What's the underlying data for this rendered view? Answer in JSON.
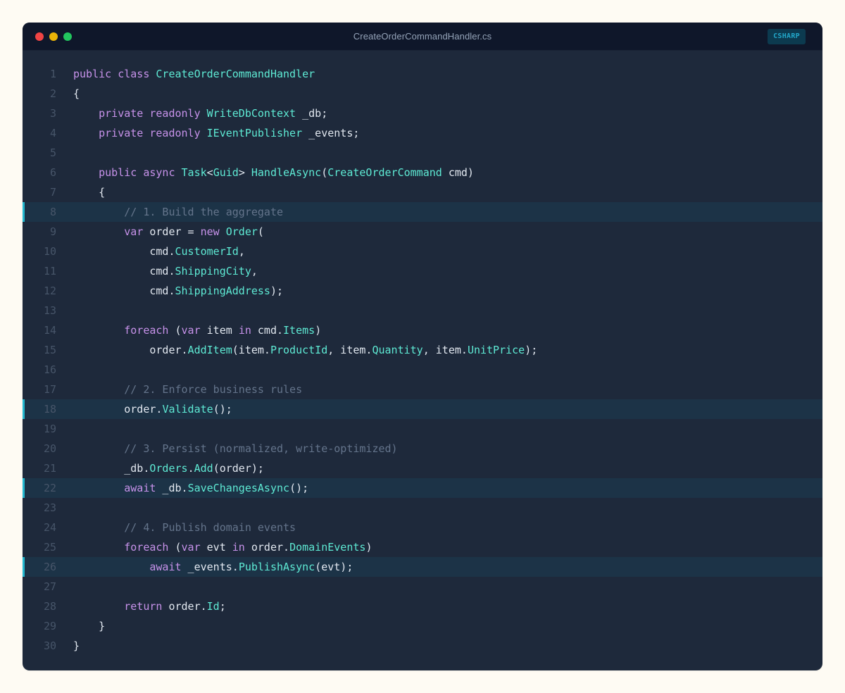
{
  "window": {
    "filename": "CreateOrderCommandHandler.cs",
    "language_badge": "CSHARP"
  },
  "colors": {
    "keyword": "#c792ea",
    "type": "#5eead4",
    "comment": "#64748b",
    "plain": "#e2e8f0",
    "highlight_bar": "#22b8cf",
    "background": "#1e293b"
  },
  "lines": [
    {
      "n": "1",
      "hl": false,
      "tokens": [
        [
          "kw",
          "public"
        ],
        [
          "pl",
          " "
        ],
        [
          "kw",
          "class"
        ],
        [
          "pl",
          " "
        ],
        [
          "ty",
          "CreateOrderCommandHandler"
        ]
      ]
    },
    {
      "n": "2",
      "hl": false,
      "tokens": [
        [
          "pl",
          "{"
        ]
      ]
    },
    {
      "n": "3",
      "hl": false,
      "tokens": [
        [
          "pl",
          "    "
        ],
        [
          "kw",
          "private"
        ],
        [
          "pl",
          " "
        ],
        [
          "kw",
          "readonly"
        ],
        [
          "pl",
          " "
        ],
        [
          "ty",
          "WriteDbContext"
        ],
        [
          "pl",
          " _db;"
        ]
      ]
    },
    {
      "n": "4",
      "hl": false,
      "tokens": [
        [
          "pl",
          "    "
        ],
        [
          "kw",
          "private"
        ],
        [
          "pl",
          " "
        ],
        [
          "kw",
          "readonly"
        ],
        [
          "pl",
          " "
        ],
        [
          "ty",
          "IEventPublisher"
        ],
        [
          "pl",
          " _events;"
        ]
      ]
    },
    {
      "n": "5",
      "hl": false,
      "tokens": []
    },
    {
      "n": "6",
      "hl": false,
      "tokens": [
        [
          "pl",
          "    "
        ],
        [
          "kw",
          "public"
        ],
        [
          "pl",
          " "
        ],
        [
          "kw",
          "async"
        ],
        [
          "pl",
          " "
        ],
        [
          "ty",
          "Task"
        ],
        [
          "pl",
          "<"
        ],
        [
          "ty",
          "Guid"
        ],
        [
          "pl",
          "> "
        ],
        [
          "fn",
          "HandleAsync"
        ],
        [
          "pl",
          "("
        ],
        [
          "ty",
          "CreateOrderCommand"
        ],
        [
          "pl",
          " cmd)"
        ]
      ]
    },
    {
      "n": "7",
      "hl": false,
      "tokens": [
        [
          "pl",
          "    {"
        ]
      ]
    },
    {
      "n": "8",
      "hl": true,
      "tokens": [
        [
          "pl",
          "        "
        ],
        [
          "cm",
          "// 1. Build the aggregate"
        ]
      ]
    },
    {
      "n": "9",
      "hl": false,
      "tokens": [
        [
          "pl",
          "        "
        ],
        [
          "kw",
          "var"
        ],
        [
          "pl",
          " order = "
        ],
        [
          "kw",
          "new"
        ],
        [
          "pl",
          " "
        ],
        [
          "ty",
          "Order"
        ],
        [
          "pl",
          "("
        ]
      ]
    },
    {
      "n": "10",
      "hl": false,
      "tokens": [
        [
          "pl",
          "            cmd."
        ],
        [
          "fn",
          "CustomerId"
        ],
        [
          "pl",
          ","
        ]
      ]
    },
    {
      "n": "11",
      "hl": false,
      "tokens": [
        [
          "pl",
          "            cmd."
        ],
        [
          "fn",
          "ShippingCity"
        ],
        [
          "pl",
          ","
        ]
      ]
    },
    {
      "n": "12",
      "hl": false,
      "tokens": [
        [
          "pl",
          "            cmd."
        ],
        [
          "fn",
          "ShippingAddress"
        ],
        [
          "pl",
          ");"
        ]
      ]
    },
    {
      "n": "13",
      "hl": false,
      "tokens": []
    },
    {
      "n": "14",
      "hl": false,
      "tokens": [
        [
          "pl",
          "        "
        ],
        [
          "kw",
          "foreach"
        ],
        [
          "pl",
          " ("
        ],
        [
          "kw",
          "var"
        ],
        [
          "pl",
          " item "
        ],
        [
          "kw",
          "in"
        ],
        [
          "pl",
          " cmd."
        ],
        [
          "fn",
          "Items"
        ],
        [
          "pl",
          ")"
        ]
      ]
    },
    {
      "n": "15",
      "hl": false,
      "tokens": [
        [
          "pl",
          "            order."
        ],
        [
          "fn",
          "AddItem"
        ],
        [
          "pl",
          "(item."
        ],
        [
          "fn",
          "ProductId"
        ],
        [
          "pl",
          ", item."
        ],
        [
          "fn",
          "Quantity"
        ],
        [
          "pl",
          ", item."
        ],
        [
          "fn",
          "UnitPrice"
        ],
        [
          "pl",
          ");"
        ]
      ]
    },
    {
      "n": "16",
      "hl": false,
      "tokens": []
    },
    {
      "n": "17",
      "hl": false,
      "tokens": [
        [
          "pl",
          "        "
        ],
        [
          "cm",
          "// 2. Enforce business rules"
        ]
      ]
    },
    {
      "n": "18",
      "hl": true,
      "tokens": [
        [
          "pl",
          "        order."
        ],
        [
          "fn",
          "Validate"
        ],
        [
          "pl",
          "();"
        ]
      ]
    },
    {
      "n": "19",
      "hl": false,
      "tokens": []
    },
    {
      "n": "20",
      "hl": false,
      "tokens": [
        [
          "pl",
          "        "
        ],
        [
          "cm",
          "// 3. Persist (normalized, write-optimized)"
        ]
      ]
    },
    {
      "n": "21",
      "hl": false,
      "tokens": [
        [
          "pl",
          "        _db."
        ],
        [
          "fn",
          "Orders"
        ],
        [
          "pl",
          "."
        ],
        [
          "fn",
          "Add"
        ],
        [
          "pl",
          "(order);"
        ]
      ]
    },
    {
      "n": "22",
      "hl": true,
      "tokens": [
        [
          "pl",
          "        "
        ],
        [
          "kw",
          "await"
        ],
        [
          "pl",
          " _db."
        ],
        [
          "fn",
          "SaveChangesAsync"
        ],
        [
          "pl",
          "();"
        ]
      ]
    },
    {
      "n": "23",
      "hl": false,
      "tokens": []
    },
    {
      "n": "24",
      "hl": false,
      "tokens": [
        [
          "pl",
          "        "
        ],
        [
          "cm",
          "// 4. Publish domain events"
        ]
      ]
    },
    {
      "n": "25",
      "hl": false,
      "tokens": [
        [
          "pl",
          "        "
        ],
        [
          "kw",
          "foreach"
        ],
        [
          "pl",
          " ("
        ],
        [
          "kw",
          "var"
        ],
        [
          "pl",
          " evt "
        ],
        [
          "kw",
          "in"
        ],
        [
          "pl",
          " order."
        ],
        [
          "fn",
          "DomainEvents"
        ],
        [
          "pl",
          ")"
        ]
      ]
    },
    {
      "n": "26",
      "hl": true,
      "tokens": [
        [
          "pl",
          "            "
        ],
        [
          "kw",
          "await"
        ],
        [
          "pl",
          " _events."
        ],
        [
          "fn",
          "PublishAsync"
        ],
        [
          "pl",
          "(evt);"
        ]
      ]
    },
    {
      "n": "27",
      "hl": false,
      "tokens": []
    },
    {
      "n": "28",
      "hl": false,
      "tokens": [
        [
          "pl",
          "        "
        ],
        [
          "kw",
          "return"
        ],
        [
          "pl",
          " order."
        ],
        [
          "fn",
          "Id"
        ],
        [
          "pl",
          ";"
        ]
      ]
    },
    {
      "n": "29",
      "hl": false,
      "tokens": [
        [
          "pl",
          "    }"
        ]
      ]
    },
    {
      "n": "30",
      "hl": false,
      "tokens": [
        [
          "pl",
          "}"
        ]
      ]
    }
  ]
}
